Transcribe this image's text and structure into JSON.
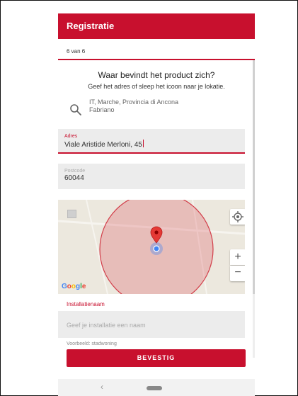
{
  "appbar": {
    "title": "Registratie"
  },
  "step": {
    "label": "6 van 6"
  },
  "location": {
    "heading": "Waar bevindt het product zich?",
    "subheading": "Geef het adres of sleep het icoon naar je lokatie.",
    "search_result_line1": "IT, Marche, Provincia di Ancona",
    "search_result_line2": "Fabriano"
  },
  "address_field": {
    "label": "Adres",
    "value": "Viale Aristide Merloni, 45"
  },
  "postcode_field": {
    "label": "Postcode",
    "value": "60044"
  },
  "map": {
    "attribution": "Google",
    "zoom_in": "+",
    "zoom_out": "−"
  },
  "installation": {
    "label": "Installatienaam",
    "placeholder": "Geef je installatie een naam",
    "example": "Voorbeeld: stadwoning"
  },
  "confirm_button": {
    "label": "BEVESTIG"
  },
  "navbar": {
    "back": "‹"
  },
  "colors": {
    "accent": "#c8102e",
    "field_bg": "#ececec",
    "map_bg": "#ece8de"
  }
}
